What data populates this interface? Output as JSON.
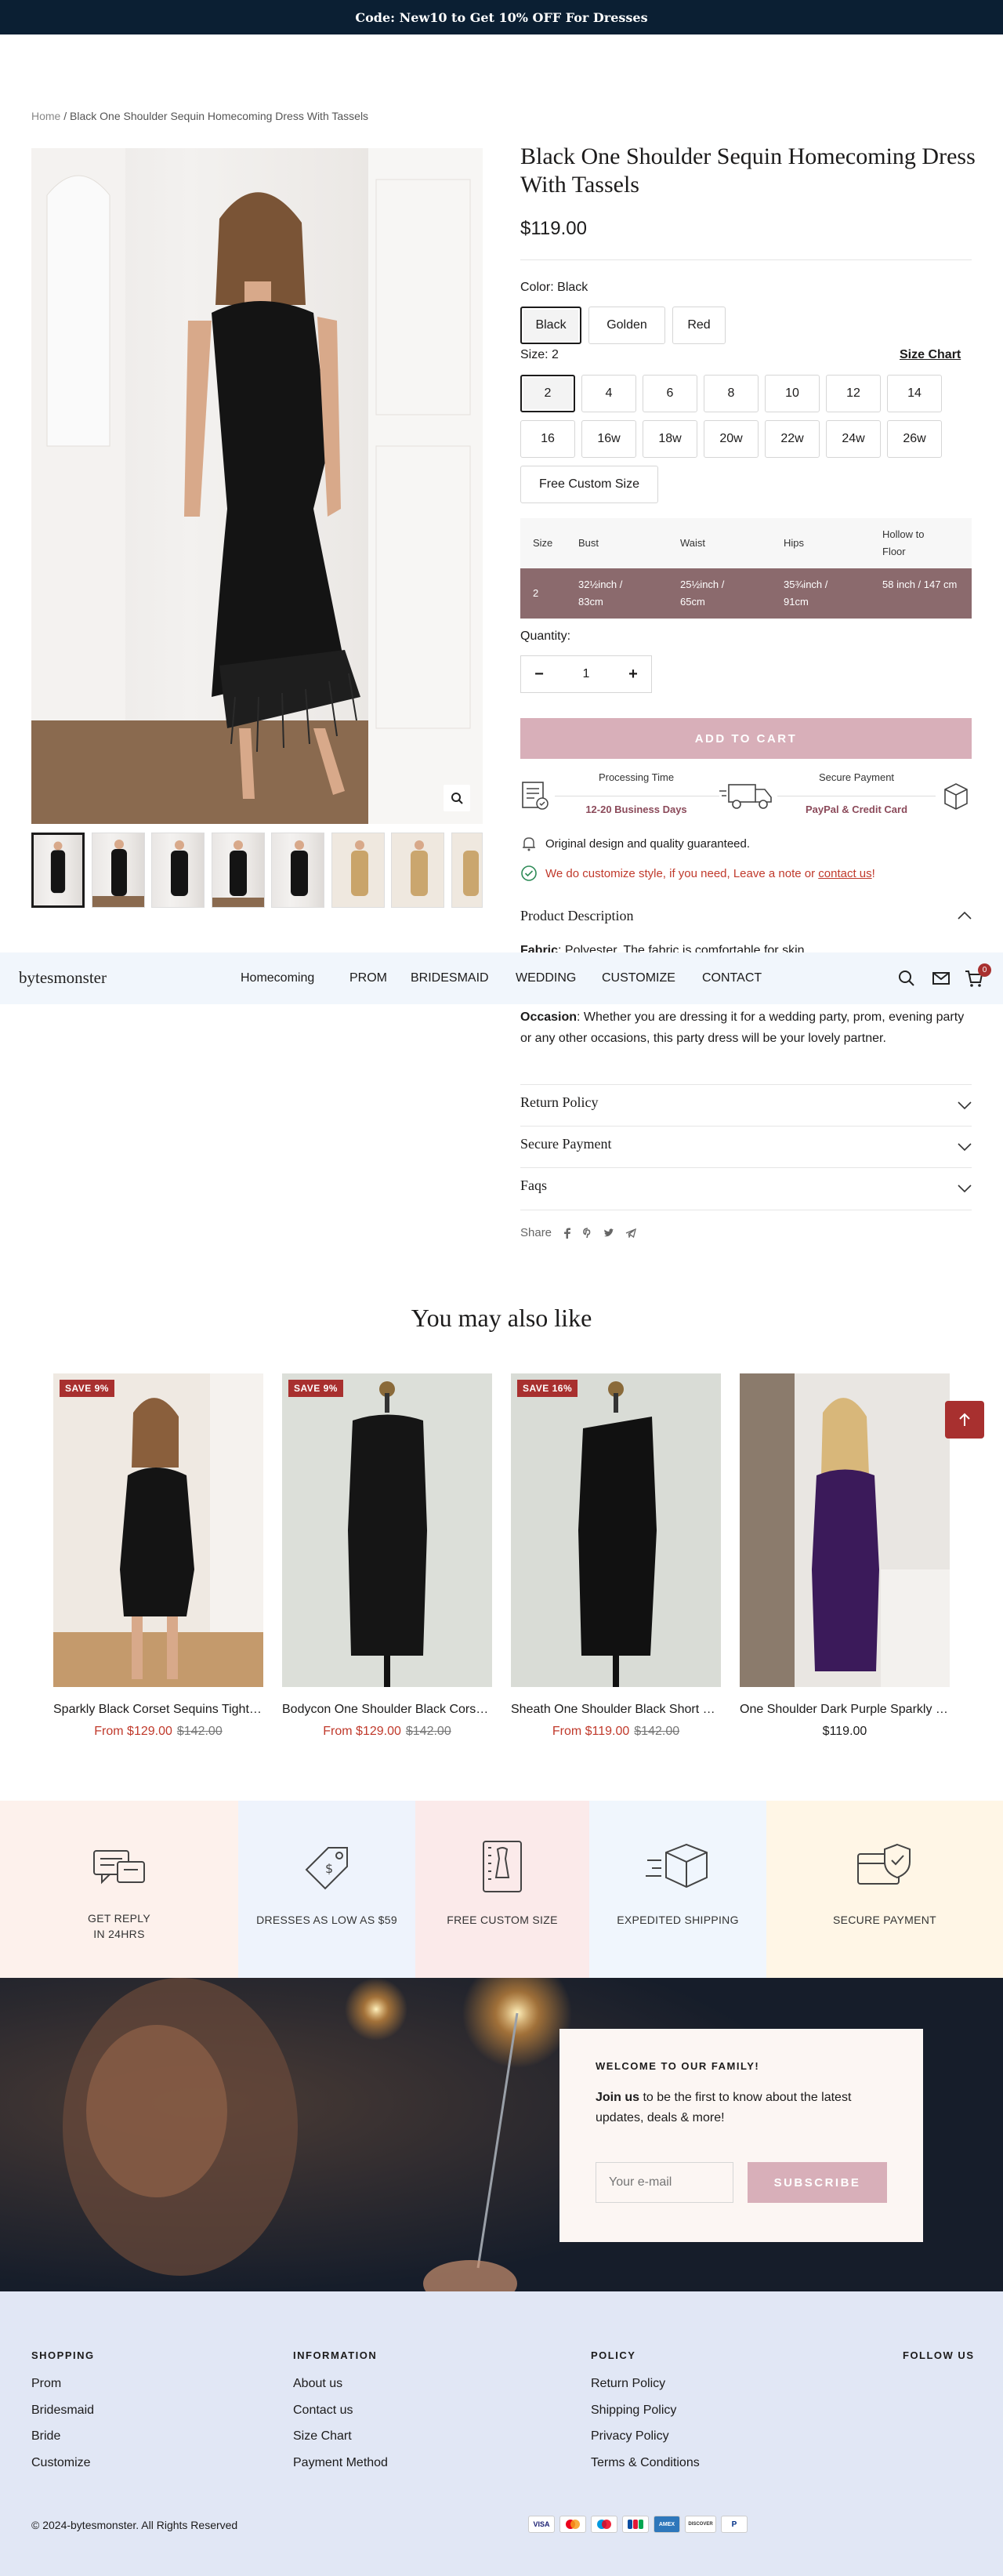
{
  "announcement": "Code: New10 to Get 10% OFF For Dresses",
  "breadcrumb": {
    "home": "Home",
    "sep": "/",
    "current": "Black One Shoulder Sequin Homecoming Dress With Tassels"
  },
  "product": {
    "title": "Black One Shoulder Sequin Homecoming Dress With Tassels",
    "price": "$119.00",
    "color_label": "Color:",
    "color_value": "Black",
    "colors": [
      "Black",
      "Golden",
      "Red"
    ],
    "size_label": "Size:",
    "size_value": "2",
    "size_chart_link": "Size Chart",
    "sizes": [
      "2",
      "4",
      "6",
      "8",
      "10",
      "12",
      "14",
      "16",
      "16w",
      "18w",
      "20w",
      "22w",
      "24w",
      "26w"
    ],
    "custom_size": "Free Custom Size",
    "size_table": {
      "headers": [
        "Size",
        "Bust",
        "Waist",
        "Hips",
        "Hollow to Floor"
      ],
      "row": [
        "2",
        "32½inch / 83cm",
        "25½inch / 65cm",
        "35¾inch / 91cm",
        "58 inch / 147 cm"
      ]
    },
    "quantity_label": "Quantity:",
    "quantity": "1",
    "qty_minus": "−",
    "qty_plus": "+",
    "add_to_cart": "ADD TO CART",
    "processing": {
      "label": "Processing Time",
      "value": "12-20 Business Days"
    },
    "secure_payment": {
      "label": "Secure Payment",
      "value": "PayPal & Credit Card"
    },
    "quality_note": "Original design and quality guaranteed.",
    "customize_note": "We do customize style, if you need, Leave a note or",
    "customize_link": "contact us",
    "customize_end": "!",
    "description_title": "Product Description",
    "fabric_label": "Fabric",
    "fabric_text": ": Polyester. The fabric is comfortable for skin.",
    "occasion_label": "Occasion",
    "occasion_text": ": Whether you are dressing it for a wedding party, prom, evening party or any other occasions, this party dress will be your lovely partner.",
    "accordions": [
      "Return Policy",
      "Secure Payment",
      "Faqs"
    ],
    "share_label": "Share"
  },
  "nav": {
    "logo": "bytesmonster",
    "links": [
      "Homecoming",
      "PROM",
      "BRIDESMAID",
      "WEDDING",
      "CUSTOMIZE",
      "CONTACT"
    ],
    "cart_count": "0"
  },
  "related": {
    "title": "You may also like",
    "items": [
      {
        "badge": "SAVE 9%",
        "name": "Sparkly Black Corset Sequins Tight Homecoming Dress",
        "sale": "From $129.00",
        "orig": "$142.00"
      },
      {
        "badge": "SAVE 9%",
        "name": "Bodycon One Shoulder Black Corset Homecoming Dress",
        "sale": "From $129.00",
        "orig": "$142.00"
      },
      {
        "badge": "SAVE 16%",
        "name": "Sheath One Shoulder Black Short Homecoming Dress",
        "sale": "From $119.00",
        "orig": "$142.00"
      },
      {
        "badge": "",
        "name": "One Shoulder Dark Purple Sparkly Homecoming Dress",
        "sale": "",
        "orig": "",
        "regular": "$119.00"
      }
    ]
  },
  "features": [
    {
      "line1": "GET REPLY",
      "line2": "IN 24HRS",
      "icon": "chat-icon",
      "bg": "#fdf1ec"
    },
    {
      "line1": "DRESSES AS LOW AS $59",
      "line2": "",
      "icon": "price-tag-icon",
      "bg": "#eef3fc"
    },
    {
      "line1": "FREE CUSTOM SIZE",
      "line2": "",
      "icon": "measure-icon",
      "bg": "#fbeaea"
    },
    {
      "line1": "EXPEDITED SHIPPING",
      "line2": "",
      "icon": "box-icon",
      "bg": "#f0f6fd"
    },
    {
      "line1": "SECURE PAYMENT",
      "line2": "",
      "icon": "shield-card-icon",
      "bg": "#fff6e6"
    }
  ],
  "newsletter": {
    "kicker": "WELCOME TO OUR FAMILY!",
    "bold": "Join us",
    "text": " to be the first to know about the latest updates, deals & more!",
    "placeholder": "Your e-mail",
    "button": "SUBSCRIBE"
  },
  "footer": {
    "shopping": {
      "title": "SHOPPING",
      "links": [
        "Prom",
        "Bridesmaid",
        "Bride",
        "Customize"
      ]
    },
    "information": {
      "title": "INFORMATION",
      "links": [
        "About us",
        "Contact us",
        "Size Chart",
        "Payment Method"
      ]
    },
    "policy": {
      "title": "POLICY",
      "links": [
        "Return Policy",
        "Shipping Policy",
        "Privacy Policy",
        "Terms & Conditions"
      ]
    },
    "follow": "FOLLOW US",
    "copyright": "© 2024-bytesmonster. All Rights Reserved",
    "payments": [
      "VISA",
      "MC",
      "Maestro",
      "JCB",
      "AMEX",
      "DISCOVER",
      "PayPal"
    ]
  },
  "colors": {
    "accent": "#d8afb9",
    "sale": "#c0392b",
    "badge": "#a8302f",
    "announce_bg": "#0b1f33",
    "table_row": "#8b6a6d"
  }
}
